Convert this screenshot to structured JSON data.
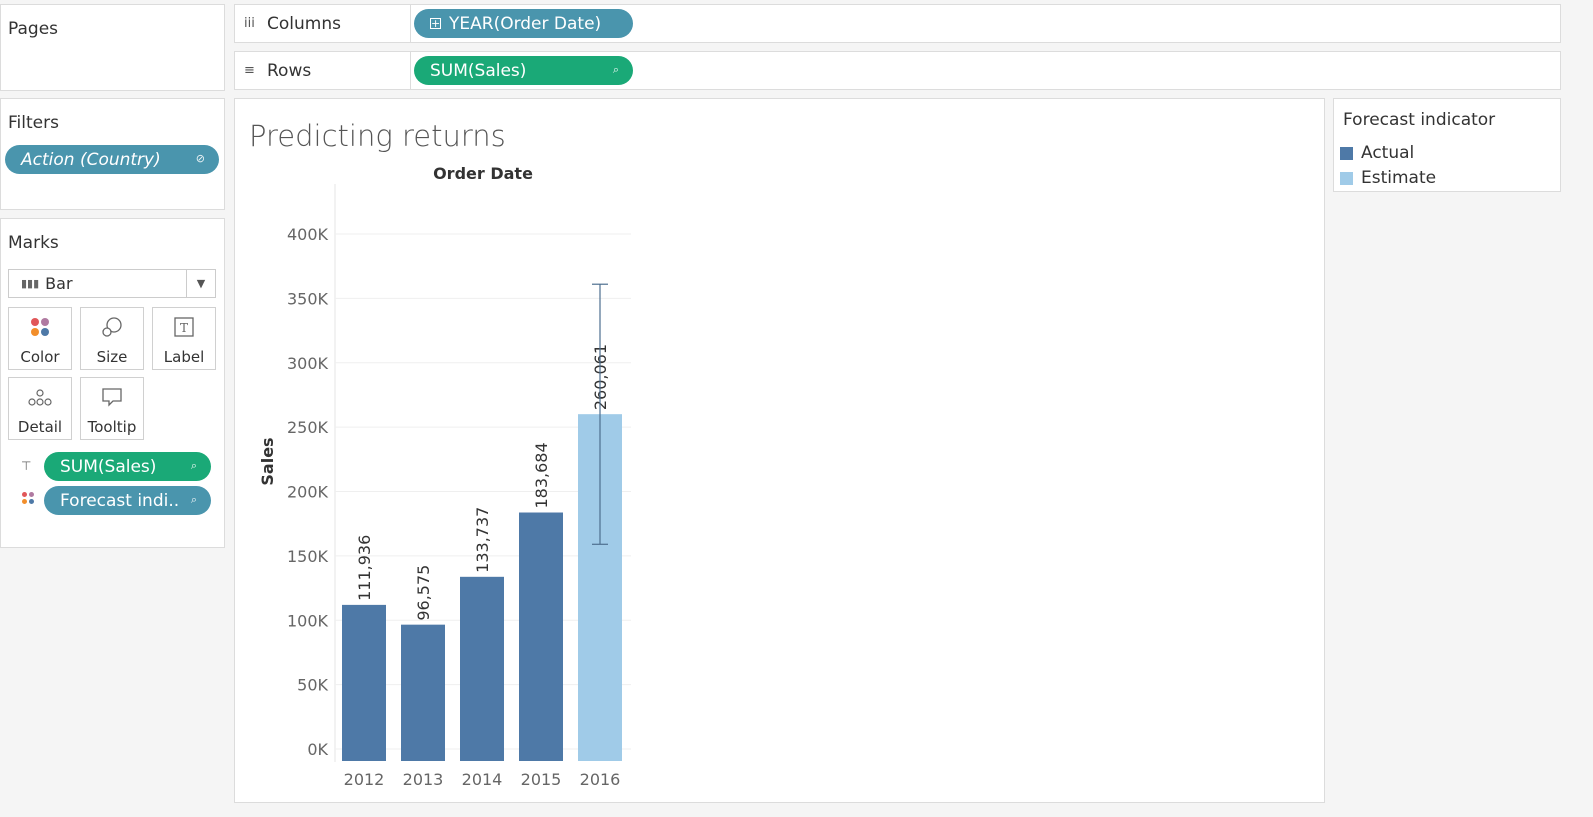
{
  "pages": {
    "title": "Pages"
  },
  "shelves": {
    "columns": {
      "label": "Columns",
      "icon": "columns-icon",
      "pill": "YEAR(Order Date)"
    },
    "rows": {
      "label": "Rows",
      "icon": "rows-icon",
      "pill": "SUM(Sales)"
    }
  },
  "filters": {
    "title": "Filters",
    "pill": "Action (Country)"
  },
  "marks": {
    "title": "Marks",
    "type": "Bar",
    "buttons": [
      "Color",
      "Size",
      "Label",
      "Detail",
      "Tooltip"
    ],
    "pills": [
      "SUM(Sales)",
      "Forecast indi.."
    ]
  },
  "viz": {
    "title": "Predicting returns",
    "column_header": "Order Date"
  },
  "legend": {
    "title": "Forecast indicator",
    "items": [
      {
        "label": "Actual",
        "color": "#4e79a7"
      },
      {
        "label": "Estimate",
        "color": "#a0cbe8"
      }
    ]
  },
  "chart_data": {
    "type": "bar",
    "xlabel": "",
    "ylabel": "Sales",
    "categories": [
      "2012",
      "2013",
      "2014",
      "2015",
      "2016"
    ],
    "values": [
      111936,
      96575,
      133737,
      183684,
      260061
    ],
    "value_labels": [
      "111,936",
      "96,575",
      "133,737",
      "183,684",
      "260,061"
    ],
    "bar_colors": [
      "#4e79a7",
      "#4e79a7",
      "#4e79a7",
      "#4e79a7",
      "#a0cbe8"
    ],
    "error_bar": {
      "category": "2016",
      "low": 159000,
      "high": 361000
    },
    "ylim": [
      0,
      430000
    ],
    "yticks": [
      0,
      50000,
      100000,
      150000,
      200000,
      250000,
      300000,
      350000,
      400000
    ],
    "ytick_labels": [
      "0K",
      "50K",
      "100K",
      "150K",
      "200K",
      "250K",
      "300K",
      "350K",
      "400K"
    ],
    "grid": true
  }
}
